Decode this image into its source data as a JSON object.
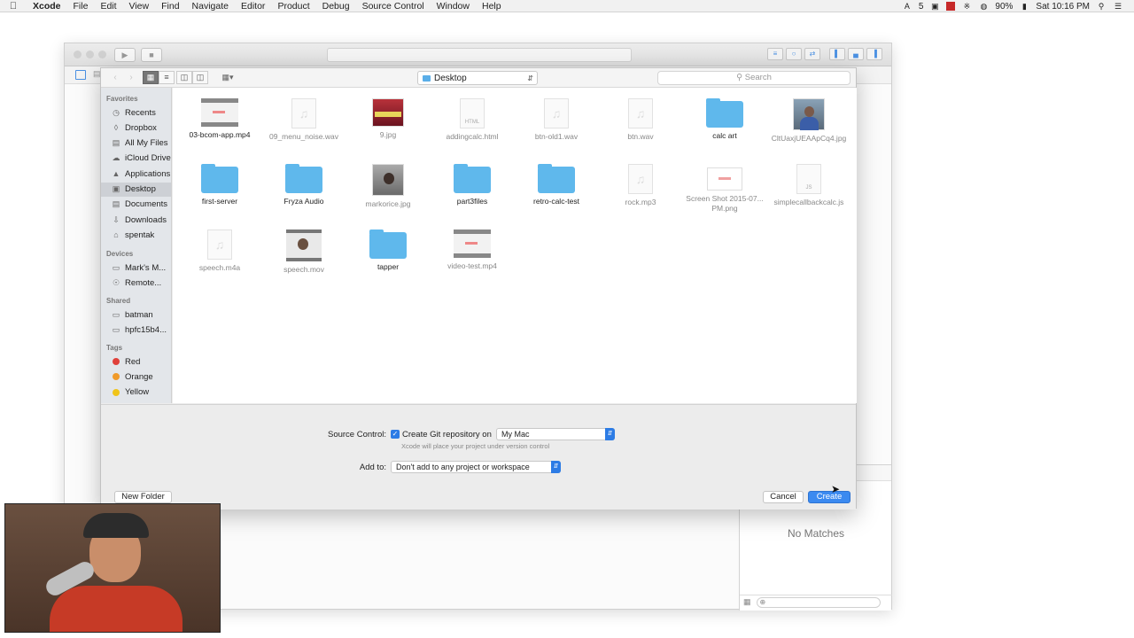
{
  "menubar": {
    "app": "Xcode",
    "menus": [
      "File",
      "Edit",
      "View",
      "Find",
      "Navigate",
      "Editor",
      "Product",
      "Debug",
      "Source Control",
      "Window",
      "Help"
    ],
    "status_num": "5",
    "battery": "90%",
    "clock": "Sat 10:16 PM"
  },
  "save_sheet": {
    "location": "Desktop",
    "search_placeholder": "Search",
    "sidebar": {
      "favorites_header": "Favorites",
      "favorites": [
        "Recents",
        "Dropbox",
        "All My Files",
        "iCloud Drive",
        "Applications",
        "Desktop",
        "Documents",
        "Downloads",
        "spentak"
      ],
      "devices_header": "Devices",
      "devices": [
        "Mark's M...",
        "Remote..."
      ],
      "shared_header": "Shared",
      "shared": [
        "batman",
        "hpfc15b4..."
      ],
      "tags_header": "Tags",
      "tags": [
        {
          "label": "Red",
          "color": "#e0403a"
        },
        {
          "label": "Orange",
          "color": "#f09a2a"
        },
        {
          "label": "Yellow",
          "color": "#f0c419"
        }
      ]
    },
    "files": [
      {
        "name": "03-bcom-app.mp4",
        "kind": "video",
        "dim": false
      },
      {
        "name": "09_menu_noise.wav",
        "kind": "audio",
        "dim": true
      },
      {
        "name": "9.jpg",
        "kind": "photo-red",
        "dim": true
      },
      {
        "name": "addingcalc.html",
        "kind": "html",
        "dim": true
      },
      {
        "name": "btn-old1.wav",
        "kind": "audio",
        "dim": true
      },
      {
        "name": "btn.wav",
        "kind": "audio",
        "dim": true
      },
      {
        "name": "calc art",
        "kind": "folder",
        "dim": false
      },
      {
        "name": "CltUaxjUEAApCq4.jpg",
        "kind": "photo-person",
        "dim": true
      },
      {
        "name": "first-server",
        "kind": "folder",
        "dim": false
      },
      {
        "name": "Fryza Audio",
        "kind": "folder",
        "dim": false
      },
      {
        "name": "markorice.jpg",
        "kind": "photo-dark",
        "dim": true
      },
      {
        "name": "part3files",
        "kind": "folder",
        "dim": false
      },
      {
        "name": "retro-calc-test",
        "kind": "folder",
        "dim": false
      },
      {
        "name": "rock.mp3",
        "kind": "audio",
        "dim": true
      },
      {
        "name": "Screen Shot 2015-07...PM.png",
        "kind": "screenshot",
        "dim": true
      },
      {
        "name": "simplecallbackcalc.js",
        "kind": "js",
        "dim": true
      },
      {
        "name": "speech.m4a",
        "kind": "audio",
        "dim": true
      },
      {
        "name": "speech.mov",
        "kind": "movie",
        "dim": true
      },
      {
        "name": "tapper",
        "kind": "folder",
        "dim": false
      },
      {
        "name": "video-test.mp4",
        "kind": "video",
        "dim": true
      }
    ],
    "source_control_label": "Source Control:",
    "git_checkbox_label": "Create Git repository on",
    "git_checked": true,
    "git_target": "My Mac",
    "git_hint": "Xcode will place your project under version control",
    "add_to_label": "Add to:",
    "add_to_value": "Don't add to any project or workspace",
    "new_folder": "New Folder",
    "cancel": "Cancel",
    "create": "Create"
  },
  "inspector": {
    "empty_text": "No Matches"
  },
  "icons": {
    "html_badge": "HTML",
    "js_badge": "JS"
  }
}
